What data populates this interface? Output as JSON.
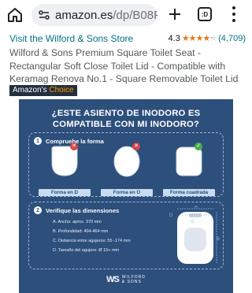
{
  "browser": {
    "url_host": "amazon.es",
    "url_path": "/dp/B08P",
    "tab_indicator": ":D"
  },
  "product": {
    "store_link": "Visit the Wilford & Sons Store",
    "rating_value": "4.3",
    "rating_stars": 4.3,
    "rating_count": "(4,709)",
    "title": "Wilford & Sons Premium Square Toilet Seat - Rectangular Soft Close Toilet Lid - Compatible with Keramag Renova No.1 - Square Removable Toilet Lid",
    "badge_part1": "Amazon's",
    "badge_part2": "Choice"
  },
  "image": {
    "heading_line1": "¿ESTE ASIENTO DE INODORO ES",
    "heading_line2": "COMPATIBLE CON MI INODORO?",
    "step1": {
      "number": "1",
      "title": "Compruebe la forma"
    },
    "shapes": [
      {
        "label": "Forma en D",
        "status": "no"
      },
      {
        "label": "Forma en O",
        "status": "no"
      },
      {
        "label": "Forma cuadrada",
        "status": "yes"
      }
    ],
    "step2": {
      "number": "2",
      "title": "Verifique las dimensiones"
    },
    "dimensions": [
      "A. Ancho: aprox. 370 mm",
      "B. Profundidad: 404-464 mm",
      "C. Distancia entre agujeros: 55 -174 mm",
      "D. Tamaño del agujero: Ø 15+ mm"
    ],
    "diagram_letters": {
      "a": "A",
      "b": "B",
      "c": "C",
      "d": "D"
    },
    "brand_mark": "WS",
    "brand_line1": "WILFORD",
    "brand_line2": "& SONS"
  },
  "colors": {
    "image_bg": "#2d4f7c",
    "link": "#007185",
    "star": "#de7921",
    "badge_bg": "#232f3e",
    "badge_accent": "#ff9900"
  }
}
